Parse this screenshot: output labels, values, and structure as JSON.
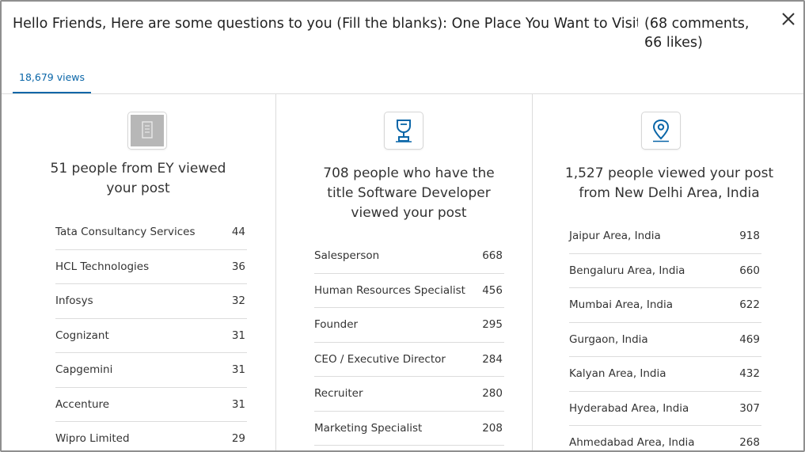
{
  "post": {
    "title": "Hello Friends, Here are some questions to you (Fill the blanks): One Place You Want to Visit __...",
    "meta": "(68 comments, 66 likes)"
  },
  "tab": {
    "label": "18,679 views"
  },
  "icons": {
    "close": "close-icon",
    "company": "building-icon",
    "title": "trophy-icon",
    "location": "map-pin-icon"
  },
  "columns": {
    "company": {
      "heading": "51 people from EY viewed your post",
      "rows": [
        {
          "label": "Tata Consultancy Services",
          "count": "44"
        },
        {
          "label": "HCL Technologies",
          "count": "36"
        },
        {
          "label": "Infosys",
          "count": "32"
        },
        {
          "label": "Cognizant",
          "count": "31"
        },
        {
          "label": "Capgemini",
          "count": "31"
        },
        {
          "label": "Accenture",
          "count": "31"
        },
        {
          "label": "Wipro Limited",
          "count": "29"
        }
      ]
    },
    "title": {
      "heading": "708 people who have the title Software Developer viewed your post",
      "rows": [
        {
          "label": "Salesperson",
          "count": "668"
        },
        {
          "label": "Human Resources Specialist",
          "count": "456"
        },
        {
          "label": "Founder",
          "count": "295"
        },
        {
          "label": "CEO / Executive Director",
          "count": "284"
        },
        {
          "label": "Recruiter",
          "count": "280"
        },
        {
          "label": "Marketing Specialist",
          "count": "208"
        }
      ]
    },
    "location": {
      "heading": "1,527 people viewed your post from New Delhi Area, India",
      "rows": [
        {
          "label": "Jaipur Area, India",
          "count": "918"
        },
        {
          "label": "Bengaluru Area, India",
          "count": "660"
        },
        {
          "label": "Mumbai Area, India",
          "count": "622"
        },
        {
          "label": "Gurgaon, India",
          "count": "469"
        },
        {
          "label": "Kalyan Area, India",
          "count": "432"
        },
        {
          "label": "Hyderabad Area, India",
          "count": "307"
        },
        {
          "label": "Ahmedabad Area, India",
          "count": "268"
        }
      ]
    }
  },
  "colors": {
    "accent": "#0a66a8",
    "divider": "#dcdcdc",
    "icon_gray": "#b7b7b7"
  }
}
